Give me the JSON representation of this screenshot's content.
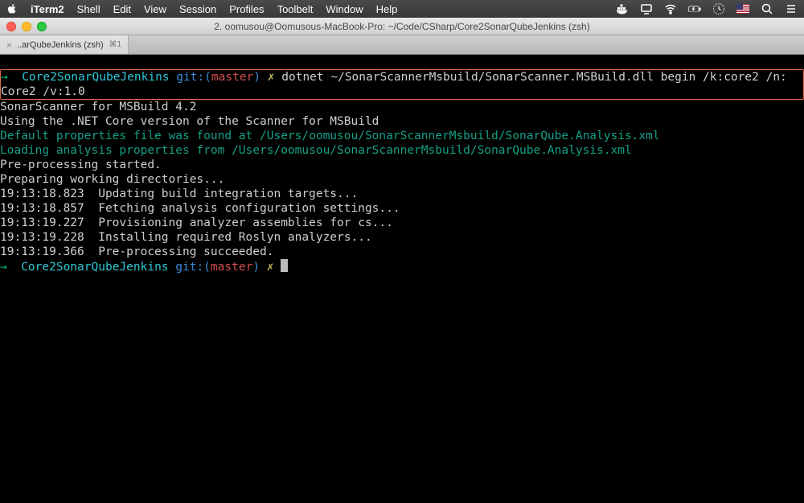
{
  "menubar": {
    "app_name": "iTerm2",
    "items": [
      "Shell",
      "Edit",
      "View",
      "Session",
      "Profiles",
      "Toolbelt",
      "Window",
      "Help"
    ]
  },
  "window": {
    "title": "2. oomusou@Oomusous-MacBook-Pro: ~/Code/CSharp/Core2SonarQubeJenkins (zsh)"
  },
  "tab": {
    "label": "..arQubeJenkins (zsh)",
    "shortcut": "⌘1"
  },
  "prompt1": {
    "arrow": "→",
    "dir": "Core2SonarQubeJenkins",
    "git_label": "git:(",
    "branch": "master",
    "git_close": ")",
    "dirty": "✗",
    "cmd_part1": "dotnet ~/SonarScannerMsbuild/SonarScanner.MSBuild.dll begin /k:core2 /n:",
    "cmd_part2": "Core2 /v:1.0"
  },
  "output": {
    "l1": "SonarScanner for MSBuild 4.2",
    "l2": "Using the .NET Core version of the Scanner for MSBuild",
    "l3": "Default properties file was found at /Users/oomusou/SonarScannerMsbuild/SonarQube.Analysis.xml",
    "l4": "Loading analysis properties from /Users/oomusou/SonarScannerMsbuild/SonarQube.Analysis.xml",
    "l5": "Pre-processing started.",
    "l6": "Preparing working directories...",
    "l7": "19:13:18.823  Updating build integration targets...",
    "l8": "19:13:18.857  Fetching analysis configuration settings...",
    "l9": "19:13:19.227  Provisioning analyzer assemblies for cs...",
    "l10": "19:13:19.228  Installing required Roslyn analyzers...",
    "l11": "19:13:19.366  Pre-processing succeeded."
  },
  "prompt2": {
    "arrow": "→",
    "dir": "Core2SonarQubeJenkins",
    "git_label": "git:(",
    "branch": "master",
    "git_close": ")",
    "dirty": "✗"
  }
}
